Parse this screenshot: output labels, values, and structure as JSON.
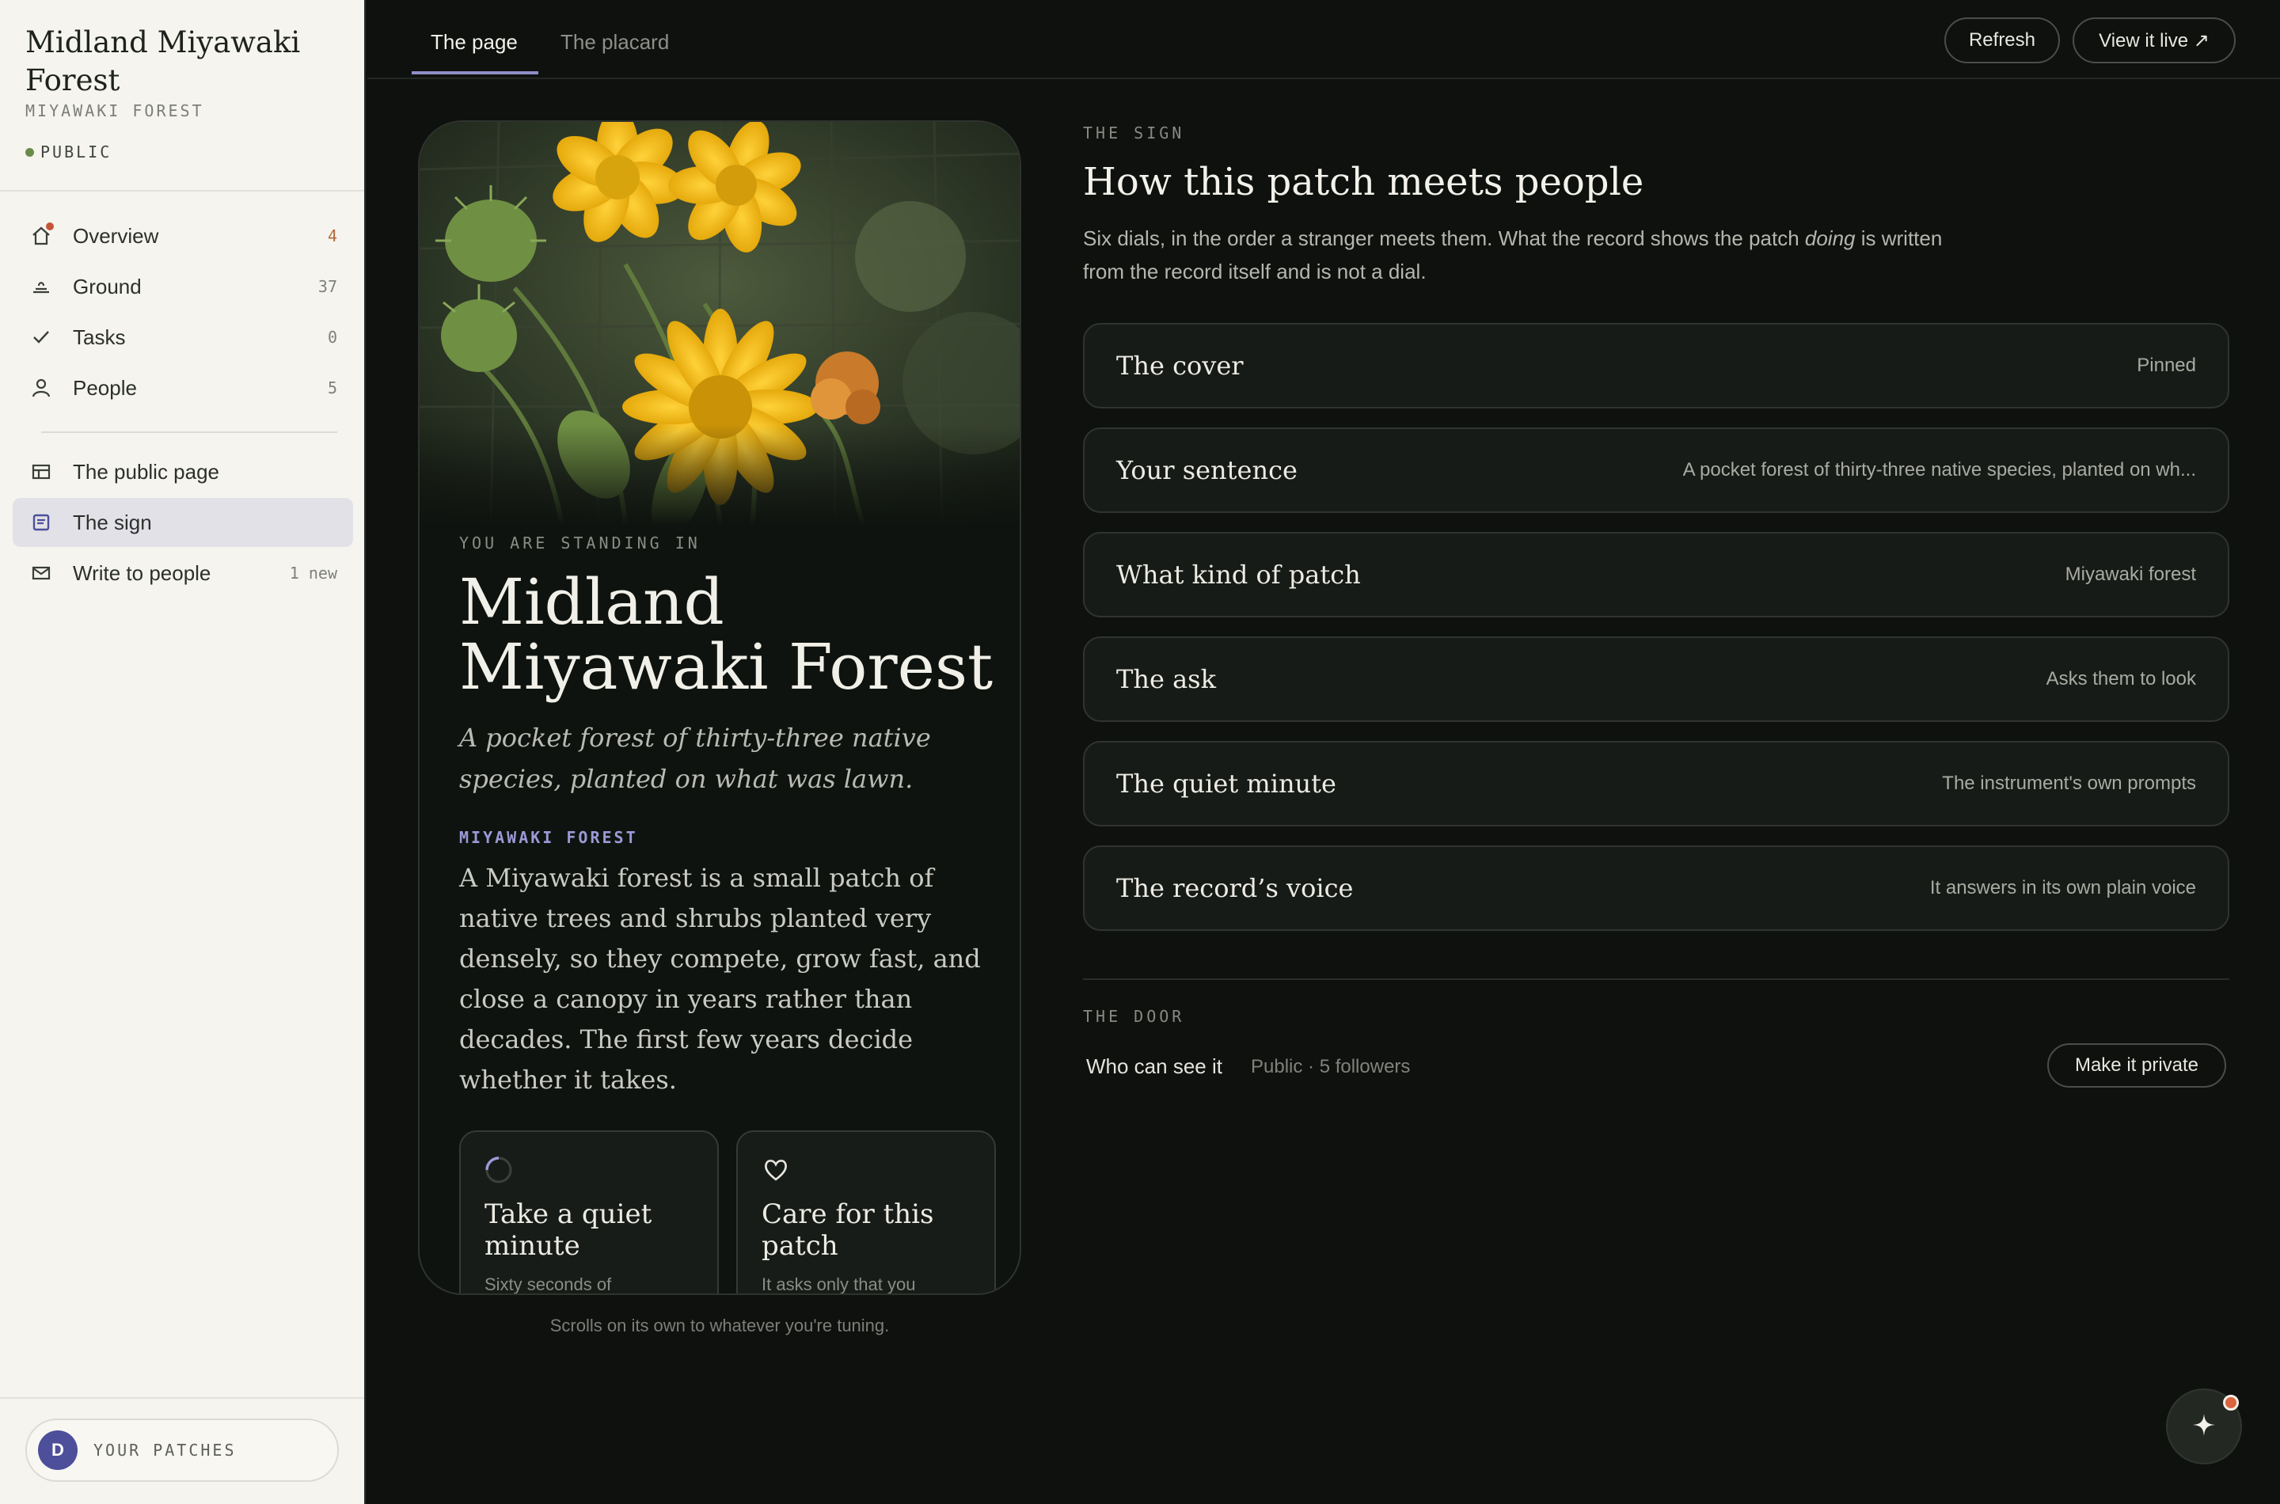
{
  "sidebar": {
    "title": "Midland Miyawaki Forest",
    "subtitle": "MIYAWAKI FOREST",
    "status": "PUBLIC",
    "nav": [
      {
        "label": "Overview",
        "count": "4",
        "icon": "home-icon"
      },
      {
        "label": "Ground",
        "count": "37",
        "icon": "ground-icon"
      },
      {
        "label": "Tasks",
        "count": "0",
        "icon": "check-icon"
      },
      {
        "label": "People",
        "count": "5",
        "icon": "person-icon"
      }
    ],
    "nav2": [
      {
        "label": "The public page",
        "count": "",
        "icon": "layout-icon"
      },
      {
        "label": "The sign",
        "count": "",
        "icon": "sign-icon"
      },
      {
        "label": "Write to people",
        "count": "1 new",
        "icon": "mail-icon"
      }
    ],
    "footer": {
      "avatar_letter": "D",
      "label": "YOUR PATCHES"
    }
  },
  "topbar": {
    "tabs": [
      "The page",
      "The placard"
    ],
    "refresh_label": "Refresh",
    "view_live_label": "View it live ↗"
  },
  "preview": {
    "kicker": "YOU ARE STANDING IN",
    "title": "Midland Miyawaki Forest",
    "tagline": "A pocket forest of thirty-three native species, planted on what was lawn.",
    "kind": "MIYAWAKI FOREST",
    "description": "A Miyawaki forest is a small patch of native trees and shrubs planted very densely, so they compete, grow fast, and close a canopy in years rather than decades. The first few years decide whether it takes.",
    "cards": [
      {
        "title": "Take a quiet minute",
        "sub": "Sixty seconds of",
        "icon": "spinner-icon"
      },
      {
        "title": "Care for this patch",
        "sub": "It asks only that you",
        "icon": "heart-icon"
      }
    ],
    "caption": "Scrolls on its own to whatever you're tuning."
  },
  "sign": {
    "kicker": "THE SIGN",
    "heading": "How this patch meets people",
    "intro_a": "Six dials, in the order a stranger meets them. What the record shows the patch ",
    "intro_em": "doing",
    "intro_b": " is written from the record itself and is not a dial.",
    "dials": [
      {
        "name": "The cover",
        "value": "Pinned"
      },
      {
        "name": "Your sentence",
        "value": "A pocket forest of thirty-three native species, planted on wh..."
      },
      {
        "name": "What kind of patch",
        "value": "Miyawaki forest"
      },
      {
        "name": "The ask",
        "value": "Asks them to look"
      },
      {
        "name": "The quiet minute",
        "value": "The instrument's own prompts"
      },
      {
        "name": "The record’s voice",
        "value": "It answers in its own plain voice"
      }
    ]
  },
  "door": {
    "kicker": "THE DOOR",
    "label": "Who can see it",
    "value": "Public · 5 followers",
    "button": "Make it private"
  },
  "colors": {
    "accent": "#8f8dc8",
    "status_green": "#6b8a4a",
    "notify": "#d9643f"
  }
}
